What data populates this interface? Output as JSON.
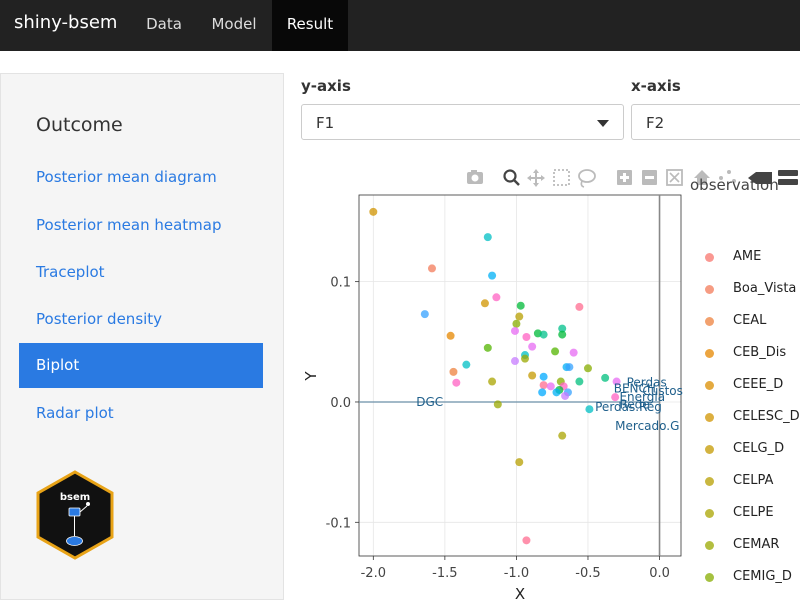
{
  "navbar": {
    "brand": "shiny-bsem",
    "tabs": [
      {
        "label": "Data"
      },
      {
        "label": "Model"
      },
      {
        "label": "Result"
      }
    ]
  },
  "sidebar": {
    "title": "Outcome",
    "items": [
      {
        "label": "Posterior mean diagram"
      },
      {
        "label": "Posterior mean heatmap"
      },
      {
        "label": "Traceplot"
      },
      {
        "label": "Posterior density"
      },
      {
        "label": "Biplot"
      },
      {
        "label": "Radar plot"
      }
    ],
    "active_item": "Biplot",
    "logo_text": "bsem"
  },
  "controls": {
    "y_axis": {
      "label": "y-axis",
      "value": "F1"
    },
    "x_axis": {
      "label": "x-axis",
      "value": "F2"
    }
  },
  "modebar": {
    "icons": [
      "camera-icon",
      "zoom-icon",
      "pan-icon",
      "box-select-icon",
      "lasso-icon",
      "zoom-in-icon",
      "zoom-out-icon",
      "autoscale-icon",
      "home-icon",
      "spike-lines-icon",
      "hover-closest-icon",
      "hover-compare-icon"
    ]
  },
  "legend": {
    "title": "observation",
    "items": [
      {
        "label": "AME",
        "color": "#F8766D"
      },
      {
        "label": "Boa_Vista",
        "color": "#F37B59"
      },
      {
        "label": "CEAL",
        "color": "#ED813E"
      },
      {
        "label": "CEB_Dis",
        "color": "#E58700"
      },
      {
        "label": "CEEE_D",
        "color": "#DB8E00"
      },
      {
        "label": "CELESC_D",
        "color": "#D09400"
      },
      {
        "label": "CELG_D",
        "color": "#C49A00"
      },
      {
        "label": "CELPA",
        "color": "#B79F00"
      },
      {
        "label": "CELPE",
        "color": "#A9A400"
      },
      {
        "label": "CEMAR",
        "color": "#99A800"
      },
      {
        "label": "CEMIG_D",
        "color": "#87AC00"
      }
    ]
  },
  "chart_data": {
    "type": "scatter",
    "xlabel": "X",
    "ylabel": "Y",
    "xlim": [
      -2.1,
      0.15
    ],
    "ylim": [
      -0.128,
      0.172
    ],
    "xticks": [
      "-2.0",
      "-1.5",
      "-1.0",
      "-0.5",
      "0.0"
    ],
    "yticks": [
      "0.1",
      "0.0",
      "-0.1"
    ],
    "points": [
      {
        "x": -2.0,
        "y": 0.158,
        "color": "#D09400"
      },
      {
        "x": -1.2,
        "y": 0.137,
        "color": "#00BFC4"
      },
      {
        "x": -1.59,
        "y": 0.111,
        "color": "#F37B59"
      },
      {
        "x": -1.17,
        "y": 0.105,
        "color": "#00B0F6"
      },
      {
        "x": -1.64,
        "y": 0.073,
        "color": "#35A2FF"
      },
      {
        "x": -1.14,
        "y": 0.087,
        "color": "#FF61C3"
      },
      {
        "x": -1.22,
        "y": 0.082,
        "color": "#D09400"
      },
      {
        "x": -0.97,
        "y": 0.08,
        "color": "#00BA38"
      },
      {
        "x": -0.56,
        "y": 0.079,
        "color": "#FF6C90"
      },
      {
        "x": -0.98,
        "y": 0.071,
        "color": "#B79F00"
      },
      {
        "x": -1.0,
        "y": 0.065,
        "color": "#87AC00"
      },
      {
        "x": -0.68,
        "y": 0.061,
        "color": "#00C08B"
      },
      {
        "x": -1.46,
        "y": 0.055,
        "color": "#E58700"
      },
      {
        "x": -1.01,
        "y": 0.059,
        "color": "#E76BF3"
      },
      {
        "x": -0.85,
        "y": 0.057,
        "color": "#00BA38"
      },
      {
        "x": -0.81,
        "y": 0.056,
        "color": "#00C08B"
      },
      {
        "x": -0.93,
        "y": 0.054,
        "color": "#FF61C3"
      },
      {
        "x": -0.68,
        "y": 0.056,
        "color": "#00BA38"
      },
      {
        "x": -0.89,
        "y": 0.046,
        "color": "#E76BF3"
      },
      {
        "x": -1.2,
        "y": 0.045,
        "color": "#53B400"
      },
      {
        "x": -0.6,
        "y": 0.041,
        "color": "#E76BF3"
      },
      {
        "x": -0.94,
        "y": 0.039,
        "color": "#00BFC4"
      },
      {
        "x": -0.73,
        "y": 0.042,
        "color": "#53B400"
      },
      {
        "x": -1.01,
        "y": 0.034,
        "color": "#C77CFF"
      },
      {
        "x": -0.94,
        "y": 0.036,
        "color": "#99A800"
      },
      {
        "x": -0.5,
        "y": 0.028,
        "color": "#87AC00"
      },
      {
        "x": -0.65,
        "y": 0.029,
        "color": "#00B0F6"
      },
      {
        "x": -1.35,
        "y": 0.031,
        "color": "#00BFC4"
      },
      {
        "x": -0.63,
        "y": 0.029,
        "color": "#35A2FF"
      },
      {
        "x": -1.44,
        "y": 0.025,
        "color": "#ED813E"
      },
      {
        "x": -0.89,
        "y": 0.022,
        "color": "#C49A00"
      },
      {
        "x": -0.81,
        "y": 0.021,
        "color": "#00A9FF"
      },
      {
        "x": -0.38,
        "y": 0.02,
        "color": "#00BF7D"
      },
      {
        "x": -0.56,
        "y": 0.017,
        "color": "#00BF7D"
      },
      {
        "x": -0.3,
        "y": 0.017,
        "color": "#E76BF3"
      },
      {
        "x": -1.17,
        "y": 0.017,
        "color": "#A9A400"
      },
      {
        "x": -1.42,
        "y": 0.016,
        "color": "#FF61C3"
      },
      {
        "x": -0.69,
        "y": 0.017,
        "color": "#87AC00"
      },
      {
        "x": -0.81,
        "y": 0.014,
        "color": "#FF6C90"
      },
      {
        "x": -0.76,
        "y": 0.013,
        "color": "#E76BF3"
      },
      {
        "x": -0.67,
        "y": 0.013,
        "color": "#FF61C3"
      },
      {
        "x": -0.7,
        "y": 0.01,
        "color": "#00BA38"
      },
      {
        "x": -0.82,
        "y": 0.008,
        "color": "#00A9FF"
      },
      {
        "x": -0.72,
        "y": 0.008,
        "color": "#00B0F6"
      },
      {
        "x": -0.64,
        "y": 0.008,
        "color": "#35A2FF"
      },
      {
        "x": -0.66,
        "y": 0.005,
        "color": "#C77CFF"
      },
      {
        "x": -0.31,
        "y": 0.004,
        "color": "#FF61C3"
      },
      {
        "x": -1.13,
        "y": -0.002,
        "color": "#99A800"
      },
      {
        "x": -0.49,
        "y": -0.006,
        "color": "#00BFC4"
      },
      {
        "x": -0.68,
        "y": -0.028,
        "color": "#A9A400"
      },
      {
        "x": -0.98,
        "y": -0.05,
        "color": "#B79F00"
      },
      {
        "x": -0.93,
        "y": -0.115,
        "color": "#FF6C90"
      }
    ],
    "text_labels": [
      {
        "text": "DGC",
        "x": -1.7,
        "y": 0.0
      },
      {
        "text": "Mercado.G",
        "x": -0.31,
        "y": -0.02
      },
      {
        "text": "Perdas.Reg",
        "x": -0.45,
        "y": -0.004
      },
      {
        "text": "Perdas",
        "x": -0.23,
        "y": 0.016
      },
      {
        "text": "BENCH",
        "x": -0.32,
        "y": 0.011
      },
      {
        "text": "Energia",
        "x": -0.28,
        "y": 0.004
      },
      {
        "text": "Rede",
        "x": -0.28,
        "y": -0.002
      },
      {
        "text": "Custos",
        "x": -0.12,
        "y": 0.009
      }
    ],
    "hline": 0.0,
    "vline": 0.0,
    "grid": true
  }
}
